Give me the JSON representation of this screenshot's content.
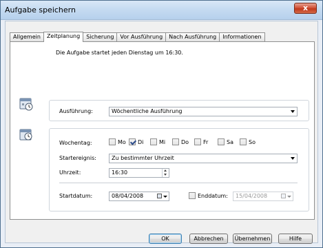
{
  "window": {
    "title": "Aufgabe speichern",
    "close_glyph": "x"
  },
  "tabs": [
    {
      "label": "Allgemein"
    },
    {
      "label": "Zeitplanung",
      "active": true
    },
    {
      "label": "Sicherung"
    },
    {
      "label": "Vor Ausführung"
    },
    {
      "label": "Nach Ausführung"
    },
    {
      "label": "Informationen"
    }
  ],
  "schedule": {
    "summary": "Die Aufgabe startet jeden Dienstag um 16:30.",
    "execution_label": "Ausführung:",
    "execution_value": "Wöchentliche Ausführung",
    "weekday_label": "Wochentag:",
    "weekdays": [
      {
        "label": "Mo",
        "checked": false
      },
      {
        "label": "Di",
        "checked": true
      },
      {
        "label": "Mi",
        "checked": false
      },
      {
        "label": "Do",
        "checked": false
      },
      {
        "label": "Fr",
        "checked": false
      },
      {
        "label": "Sa",
        "checked": false
      },
      {
        "label": "So",
        "checked": false
      }
    ],
    "start_event_label": "Startereignis:",
    "start_event_value": "Zu bestimmter Uhrzeit",
    "time_label": "Uhrzeit:",
    "time_value": "16:30",
    "start_date_label": "Startdatum:",
    "start_date_value": "08/04/2008",
    "end_date_checkbox_label": "Enddatum:",
    "end_date_enabled": false,
    "end_date_value": "15/04/2008"
  },
  "buttons": {
    "ok": "OK",
    "cancel": "Abbrechen",
    "apply": "Übernehmen",
    "help": "Hilfe"
  },
  "colors": {
    "titlebar": "#c4daf1",
    "close": "#c0381c",
    "accent_border": "#3c7fb1"
  },
  "icons": {
    "execution": "scheduler-clock-icon",
    "weekday": "calendar-clock-icon"
  }
}
